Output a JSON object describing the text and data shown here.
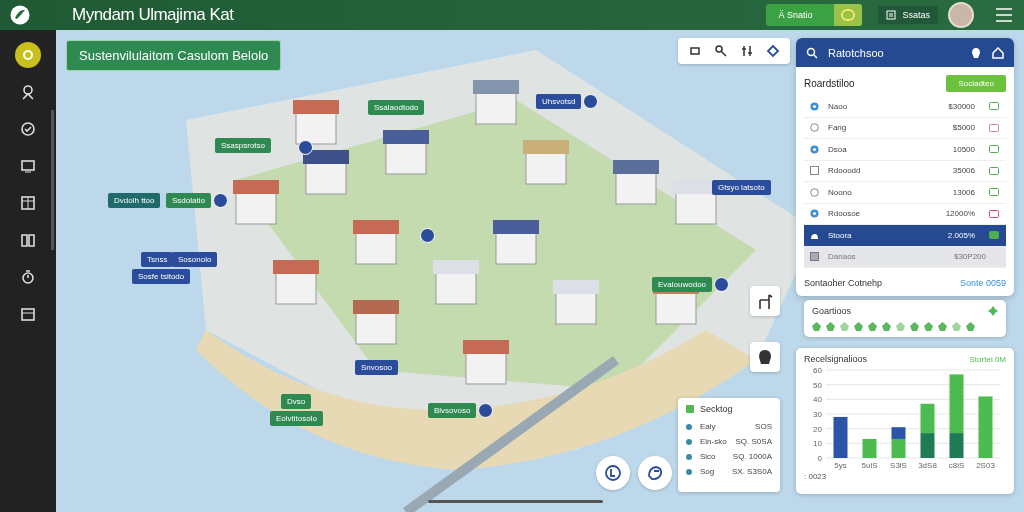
{
  "app_bar": {
    "title": "Myndam Ulmajima Kat",
    "status_button": "Ä Snatio",
    "toggle_on": true,
    "account_label": "Ssatas"
  },
  "sidebar": {
    "items": [
      {
        "selected": true
      },
      {
        "selected": false
      },
      {
        "selected": false
      },
      {
        "selected": false
      },
      {
        "selected": false
      },
      {
        "selected": false
      },
      {
        "selected": false
      },
      {
        "selected": false
      }
    ]
  },
  "map": {
    "title": "Sustenvilulaitom Casulom Belolo",
    "pins": [
      {
        "label": "Ssalaodtodo",
        "color": "#2f8a52",
        "badge": false
      },
      {
        "label": "Ssaspsrotso",
        "color": "#2f8a52",
        "badge": false
      },
      {
        "badge": true,
        "color": "#2a4c9a"
      },
      {
        "label": "Dvdolh ttoo",
        "color": "#1f6b6b",
        "badge": false
      },
      {
        "label": "Ssdolatio",
        "color": "#2f8a52",
        "badge": true
      },
      {
        "label": "Tsnss",
        "color": "#2a4c9a",
        "badge": false
      },
      {
        "label": "Sosonolo",
        "color": "#2a4c9a",
        "badge": false
      },
      {
        "label": "Sosfe tsitodo",
        "color": "#2a4c9a",
        "badge": false
      },
      {
        "label": "Uhsvotsd",
        "color": "#2a4c9a",
        "badge": true
      },
      {
        "badge": true,
        "color": "#2a4c9a"
      },
      {
        "label": "Gtsyo latsoto",
        "color": "#2a4c9a",
        "badge": false
      },
      {
        "label": "Evalouwodoo",
        "color": "#2f8a52",
        "badge": true
      },
      {
        "label": "Snvosoo",
        "color": "#2a4c9a",
        "badge": false
      },
      {
        "label": "Dvso",
        "color": "#2f8a52",
        "badge": false
      },
      {
        "label": "Eolvtitosolo",
        "color": "#2f8a52",
        "badge": false
      },
      {
        "label": "Blvsovoso",
        "color": "#2f8a52",
        "badge": true
      }
    ]
  },
  "panel": {
    "title": "Ratotchsoo",
    "heading": "Roardstiloo",
    "action": "Sociadteo",
    "rows": [
      {
        "kind": "radio",
        "name": "Naoo",
        "value": "$30000",
        "checked": true,
        "selected": false,
        "disabled": false,
        "color": "#4caf50"
      },
      {
        "kind": "radio",
        "name": "Fang",
        "value": "$5000",
        "checked": false,
        "selected": false,
        "disabled": false,
        "color": "#c98a8a"
      },
      {
        "kind": "radio",
        "name": "Dsoa",
        "value": "10500",
        "checked": true,
        "selected": false,
        "disabled": false,
        "color": "#4caf50"
      },
      {
        "kind": "checkbox",
        "name": "Rdooodd",
        "value": "35006",
        "checked": false,
        "selected": false,
        "disabled": false,
        "color": "#4caf50"
      },
      {
        "kind": "radio",
        "name": "Noono",
        "value": "13006",
        "checked": false,
        "selected": false,
        "disabled": false,
        "color": "#4caf50"
      },
      {
        "kind": "radio",
        "name": "Rdoosoe",
        "value": "12000%",
        "checked": true,
        "selected": false,
        "disabled": false,
        "color": "#d0506a"
      },
      {
        "kind": "cloud",
        "name": "Stoora",
        "value": "2.005%",
        "selected": true,
        "disabled": false,
        "color": "#4caf50"
      },
      {
        "kind": "square",
        "name": "Danaos",
        "value": "$30P200",
        "selected": false,
        "disabled": true
      }
    ],
    "footer": "Sontaoher Cotnehp",
    "footer_link": "Sonte 0059"
  },
  "goals_card": {
    "title": "Goartioos"
  },
  "chart_card": {
    "title": "Recelsignalioos",
    "tag": "Stortel 0M",
    "footnote": ": 0023",
    "chart_data": {
      "type": "bar",
      "stacked": true,
      "grid": true,
      "categories": [
        "5ys",
        "5ulS",
        "S3lS",
        "3dS8",
        "c8lS",
        "2S03"
      ],
      "yticks": [
        0,
        10,
        20,
        30,
        40,
        50,
        60
      ],
      "ylim": [
        0,
        60
      ],
      "series": [
        {
          "color": "#1f7a55",
          "values": [
            0,
            0,
            0,
            17,
            17,
            0
          ]
        },
        {
          "color": "#4cbb50",
          "values": [
            0,
            13,
            13,
            20,
            40,
            42
          ]
        },
        {
          "color": "#2a55a8",
          "values": [
            28,
            0,
            8,
            0,
            0,
            0
          ]
        }
      ]
    }
  },
  "legend_card": {
    "title": "Secktog",
    "rows": [
      {
        "name": "Ealy",
        "value": "SOS"
      },
      {
        "name": "Eln-sko",
        "value": "SQ. S0SA"
      },
      {
        "name": "Sico",
        "value": "SQ. 1000A"
      },
      {
        "name": "Sog",
        "value": "SX. S3S0A"
      }
    ]
  }
}
